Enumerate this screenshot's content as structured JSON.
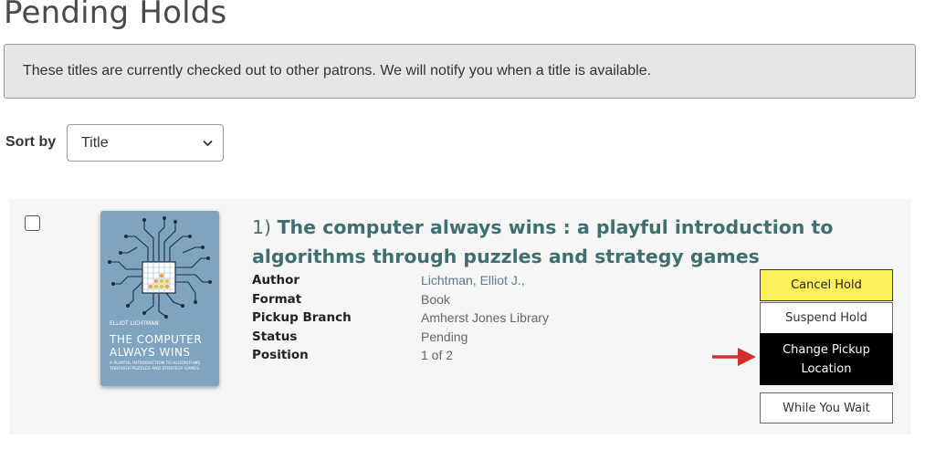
{
  "page": {
    "title": "Pending Holds"
  },
  "notice": {
    "text": "These titles are currently checked out to other patrons. We will notify you when a title is available."
  },
  "sort": {
    "label": "Sort by",
    "selected": "Title"
  },
  "holds": [
    {
      "index": "1)",
      "title": "The computer always wins : a playful introduction to algorithms through puzzles and strategy games",
      "cover": {
        "author": "ELLIOT LICHTMAN",
        "title": "THE COMPUTER ALWAYS WINS",
        "subtitle": "A PLAYFUL INTRODUCTION TO ALGORITHMS THROUGH PUZZLES AND STRATEGY GAMES",
        "color": "#7ea4bf"
      },
      "details": [
        {
          "label": "Author",
          "value": "Lichtman, Elliot J.,"
        },
        {
          "label": "Format",
          "value": "Book"
        },
        {
          "label": "Pickup Branch",
          "value": "Amherst Jones Library"
        },
        {
          "label": "Status",
          "value": "Pending"
        },
        {
          "label": "Position",
          "value": "1 of 2"
        }
      ],
      "actions": {
        "cancel": "Cancel Hold",
        "suspend": "Suspend Hold",
        "change_pickup": "Change Pickup Location",
        "while_you_wait": "While You Wait"
      }
    }
  ],
  "icons": {
    "select": "chevron-down-icon",
    "annotation": "red-arrow-icon"
  },
  "colors": {
    "cancel_bg": "#fdf05a",
    "change_bg": "#000000",
    "title_link": "#3f6f70",
    "arrow": "#d0312d"
  }
}
